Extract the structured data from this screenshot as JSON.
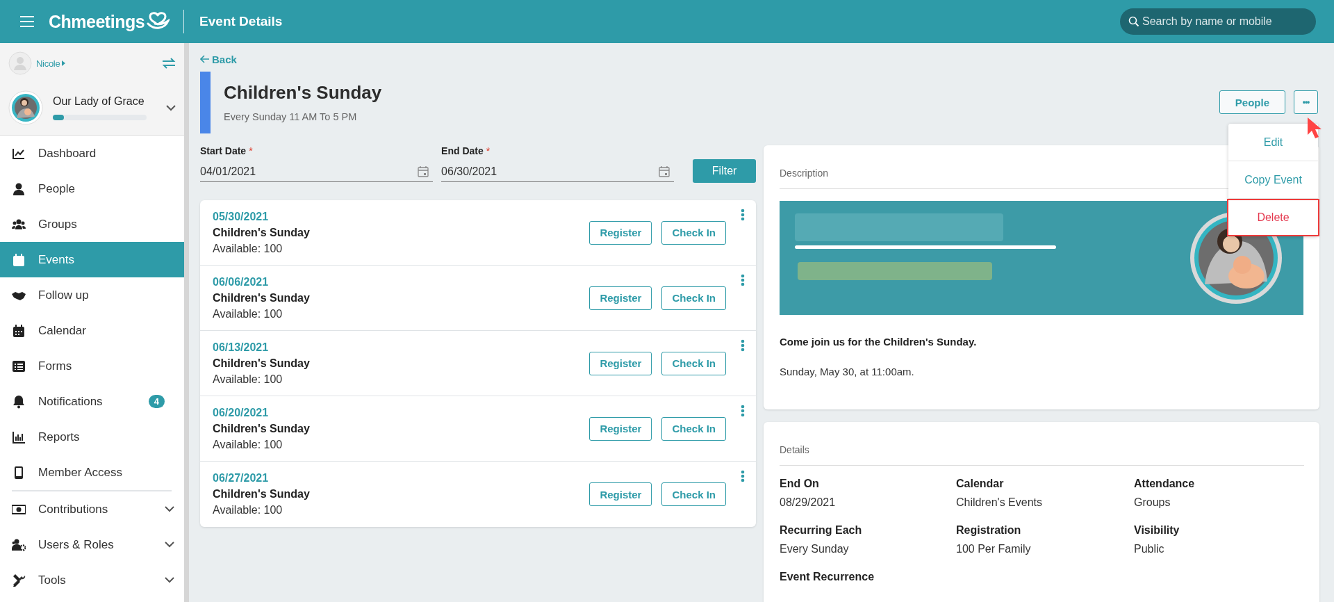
{
  "header": {
    "app_name": "Chmeetings",
    "page_title": "Event Details",
    "search": {
      "placeholder": "Search by name or mobile"
    }
  },
  "sidebar": {
    "user": "Nicole",
    "organization": {
      "name": "Our Lady of Grace",
      "level": 0.12
    },
    "sections": [
      {
        "items": [
          {
            "label": "Dashboard",
            "selected": false,
            "expandable": false
          },
          {
            "label": "People",
            "selected": false,
            "expandable": false
          },
          {
            "label": "Groups",
            "selected": false,
            "expandable": false
          },
          {
            "label": "Events",
            "selected": true,
            "expandable": false
          },
          {
            "label": "Follow up",
            "selected": false,
            "expandable": false
          },
          {
            "label": "Calendar",
            "selected": false,
            "expandable": false
          },
          {
            "label": "Forms",
            "selected": false,
            "expandable": false
          },
          {
            "label": "Notifications",
            "selected": false,
            "expandable": false,
            "badge": "4"
          },
          {
            "label": "Reports",
            "selected": false,
            "expandable": false
          },
          {
            "label": "Member Access",
            "selected": false,
            "expandable": false
          }
        ]
      },
      {
        "items": [
          {
            "label": "Contributions",
            "selected": false,
            "expandable": true
          },
          {
            "label": "Users & Roles",
            "selected": false,
            "expandable": true
          },
          {
            "label": "Tools",
            "selected": false,
            "expandable": true
          }
        ]
      }
    ]
  },
  "back": "Back",
  "event": {
    "title": "Children's Sunday",
    "schedule": "Every Sunday 11 AM To 5 PM"
  },
  "actions": {
    "button": "People",
    "more": "•••",
    "menu": [
      {
        "label": "Edit",
        "kind": "normal",
        "highlighted": false
      },
      {
        "label": "Copy Event",
        "kind": "normal",
        "highlighted": false
      },
      {
        "label": "Delete",
        "kind": "danger",
        "highlighted": true
      }
    ]
  },
  "filter": {
    "fields": [
      {
        "label": "Start Date",
        "required_mark": "*",
        "value": "04/01/2021"
      },
      {
        "label": "End Date",
        "required_mark": "*",
        "value": "06/30/2021"
      }
    ],
    "button": "Filter"
  },
  "occurrences": [
    {
      "date": "05/30/2021",
      "name": "Children's Sunday",
      "available": "Available: 100",
      "buttons": [
        "Register",
        "Check In"
      ]
    },
    {
      "date": "06/06/2021",
      "name": "Children's Sunday",
      "available": "Available: 100",
      "buttons": [
        "Register",
        "Check In"
      ]
    },
    {
      "date": "06/13/2021",
      "name": "Children's Sunday",
      "available": "Available: 100",
      "buttons": [
        "Register",
        "Check In"
      ]
    },
    {
      "date": "06/20/2021",
      "name": "Children's Sunday",
      "available": "Available: 100",
      "buttons": [
        "Register",
        "Check In"
      ]
    },
    {
      "date": "06/27/2021",
      "name": "Children's Sunday",
      "available": "Available: 100",
      "buttons": [
        "Register",
        "Check In"
      ]
    }
  ],
  "description": {
    "title": "Description",
    "paragraphs": [
      {
        "text": "Come join us for the Children's Sunday.",
        "bold": true
      },
      {
        "text": "Sunday, May 30, at 11:00am.",
        "bold": false
      }
    ]
  },
  "details": {
    "title": "Details",
    "fields": [
      {
        "label": "End On",
        "value": "08/29/2021"
      },
      {
        "label": "Calendar",
        "value": "Children's Events"
      },
      {
        "label": "Attendance",
        "value": "Groups"
      },
      {
        "label": "Recurring Each",
        "value": "Every Sunday"
      },
      {
        "label": "Registration",
        "value": "100 Per Family"
      },
      {
        "label": "Visibility",
        "value": "Public"
      },
      {
        "label": "Event Recurrence"
      }
    ]
  }
}
